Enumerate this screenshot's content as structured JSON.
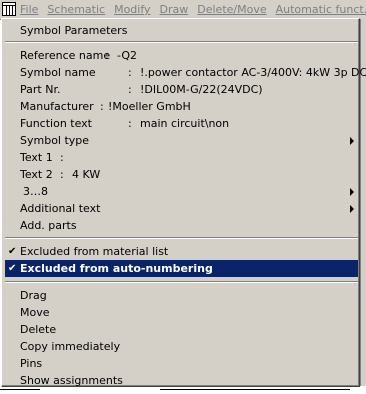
{
  "menubar": {
    "items": [
      "File",
      "Schematic",
      "Modify",
      "Draw",
      "Delete/Move",
      "Automatic funct."
    ]
  },
  "popup": {
    "title": "Symbol Parameters",
    "props": [
      {
        "label": "Reference name",
        "sep": ":",
        "value": "-Q2"
      },
      {
        "label": "Symbol name",
        "sep": ":",
        "value": "!.power contactor AC-3/400V: 4kW 3p DC"
      },
      {
        "label": "Part Nr.",
        "sep": ":",
        "value": "!DIL00M-G/22(24VDC)"
      },
      {
        "label": "Manufacturer",
        "sep": ":",
        "value": "!Moeller GmbH"
      },
      {
        "label": "Function text",
        "sep": ":",
        "value": "main circuit\\non"
      }
    ],
    "symbol_type": "Symbol type",
    "text1": {
      "label": "Text 1",
      "sep": ":",
      "value": ""
    },
    "text2": {
      "label": "Text 2",
      "sep": ":",
      "value": "4 KW"
    },
    "range": "3…8",
    "additional_text": "Additional text",
    "add_parts": "Add. parts",
    "excluded_material": "Excluded from material list",
    "excluded_autonum": "Excluded from auto-numbering",
    "actions": [
      "Drag",
      "Move",
      "Delete",
      "Copy immediately",
      "Pins",
      "Show assignments"
    ],
    "check_glyph": "✔"
  }
}
